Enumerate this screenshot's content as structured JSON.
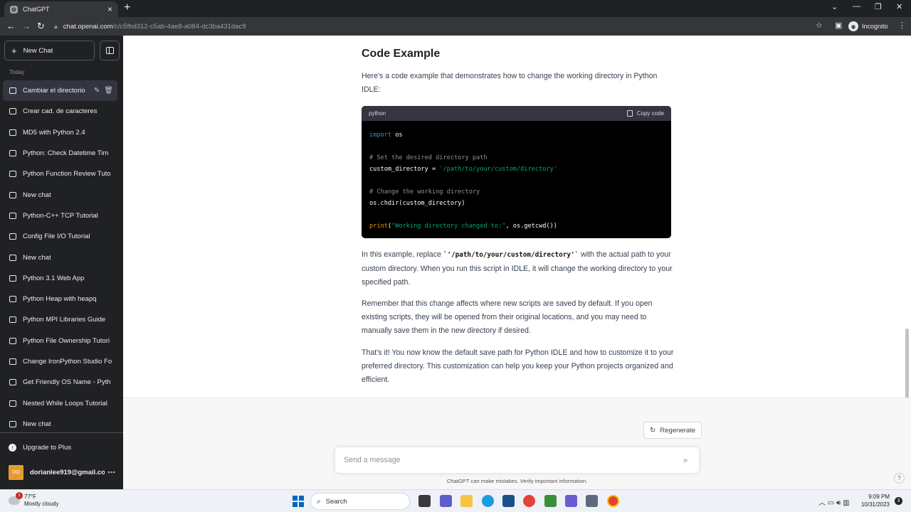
{
  "browser": {
    "tab_title": "ChatGPT",
    "url_host": "chat.openai.com",
    "url_path": "/c/c5fbd312-c5ab-4ae8-a084-dc3ba431dac9",
    "incognito_label": "Incognito"
  },
  "sidebar": {
    "new_chat_label": "New Chat",
    "section_label": "Today",
    "conversations": [
      "Cambiar el directorio",
      "Crear cad. de caracteres",
      "MD5 with Python 2.4",
      "Python: Check Datetime Tim",
      "Python Function Review Tuto",
      "New chat",
      "Python-C++ TCP Tutorial",
      "Config File I/O Tutorial",
      "New chat",
      "Python 3.1 Web App",
      "Python Heap with heapq",
      "Python MPI Libraries Guide",
      "Python File Ownership Tutori",
      "Change IronPython Studio Fo",
      "Get Friendly OS Name - Pyth",
      "Nested While Loops Tutorial",
      "New chat"
    ],
    "upgrade_label": "Upgrade to Plus",
    "user_initials": "DO",
    "user_email": "dorianlee919@gmail.co"
  },
  "content": {
    "heading": "Code Example",
    "intro": "Here's a code example that demonstrates how to change the working directory in Python IDLE:",
    "code_language": "python",
    "copy_label": "Copy code",
    "code": {
      "line1_kw": "import",
      "line1_rest": " os",
      "comment1": "# Set the desired directory path",
      "assign_lhs": "custom_directory = ",
      "assign_str": "'/path/to/your/custom/directory'",
      "comment2": "# Change the working directory",
      "chdir_line": "os.chdir(custom_directory)",
      "print_fn": "print",
      "print_open": "(",
      "print_str": "\"Working directory changed to:\"",
      "print_rest": ", os.getcwd())"
    },
    "para2_before": "In this example, replace ",
    "para2_code": "`'/path/to/your/custom/directory'`",
    "para2_after": " with the actual path to your custom directory. When you run this script in IDLE, it will change the working directory to your specified path.",
    "para3": "Remember that this change affects where new scripts are saved by default. If you open existing scripts, they will be opened from their original locations, and you may need to manually save them in the new directory if desired.",
    "para4": "That's it! You now know the default save path for Python IDLE and how to customize it to your preferred directory. This customization can help you keep your Python projects organized and efficient."
  },
  "composer": {
    "regenerate_label": "Regenerate",
    "placeholder": "Send a message",
    "disclaimer": "ChatGPT can make mistakes. Verify important information.",
    "help_label": "?"
  },
  "taskbar": {
    "weather_temp": "77°F",
    "weather_desc": "Mostly cloudy",
    "weather_badge": "1",
    "search_label": "Search",
    "time": "9:09 PM",
    "date": "10/31/2023",
    "notification_count": "3"
  },
  "colors": {
    "sidebar_bg": "#202123",
    "accent_avatar": "#e59b2f",
    "code_bg": "#000000"
  }
}
